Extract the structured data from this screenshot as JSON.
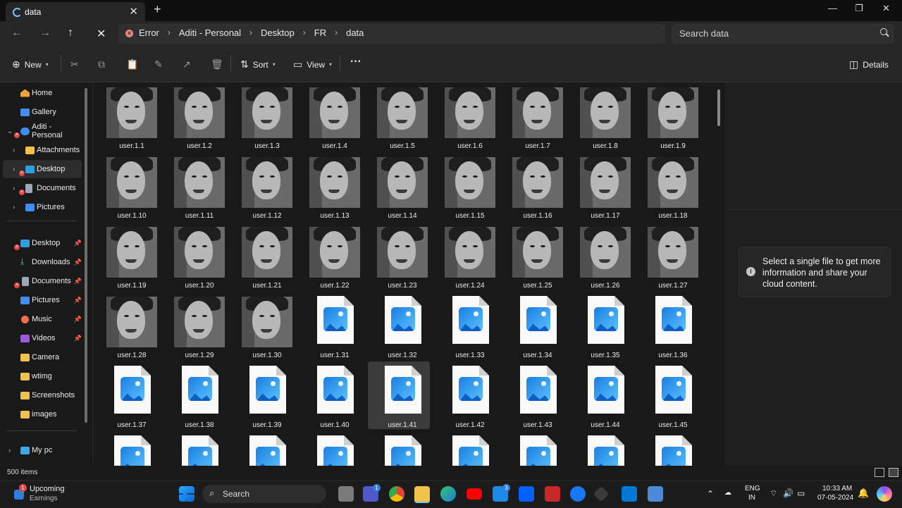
{
  "window": {
    "tab_title": "data",
    "tab_close": "✕",
    "new_tab": "+",
    "minimize": "—",
    "maximize": "❐",
    "close": "✕"
  },
  "address": {
    "back": "←",
    "forward": "→",
    "up": "↑",
    "stop": "✕",
    "error_label": "Error",
    "crumbs": [
      "Aditi - Personal",
      "Desktop",
      "FR",
      "data"
    ],
    "search_placeholder": "Search data"
  },
  "toolbar": {
    "new_label": "New",
    "sort_label": "Sort",
    "view_label": "View",
    "more": "···",
    "details_label": "Details"
  },
  "sidebar": {
    "items": [
      {
        "label": "Home"
      },
      {
        "label": "Gallery"
      },
      {
        "label": "Aditi - Personal"
      },
      {
        "label": "Attachments"
      },
      {
        "label": "Desktop"
      },
      {
        "label": "Documents"
      },
      {
        "label": "Pictures"
      },
      {
        "label": "Desktop"
      },
      {
        "label": "Downloads"
      },
      {
        "label": "Documents"
      },
      {
        "label": "Pictures"
      },
      {
        "label": "Music"
      },
      {
        "label": "Videos"
      },
      {
        "label": "Camera"
      },
      {
        "label": "wtimg"
      },
      {
        "label": "Screenshots"
      },
      {
        "label": "images"
      },
      {
        "label": "My pc"
      }
    ]
  },
  "files": [
    "user.1.1",
    "user.1.2",
    "user.1.3",
    "user.1.4",
    "user.1.5",
    "user.1.6",
    "user.1.7",
    "user.1.8",
    "user.1.9",
    "user.1.10",
    "user.1.11",
    "user.1.12",
    "user.1.13",
    "user.1.14",
    "user.1.15",
    "user.1.16",
    "user.1.17",
    "user.1.18",
    "user.1.19",
    "user.1.20",
    "user.1.21",
    "user.1.22",
    "user.1.23",
    "user.1.24",
    "user.1.25",
    "user.1.26",
    "user.1.27",
    "user.1.28",
    "user.1.29",
    "user.1.30",
    "user.1.31",
    "user.1.32",
    "user.1.33",
    "user.1.34",
    "user.1.35",
    "user.1.36",
    "user.1.37",
    "user.1.38",
    "user.1.39",
    "user.1.40",
    "user.1.41",
    "user.1.42",
    "user.1.43",
    "user.1.44",
    "user.1.45",
    "",
    "",
    "",
    "",
    "",
    "",
    "",
    "",
    ""
  ],
  "selected_file": "user.1.41",
  "details": {
    "message": "Select a single file to get more information and share your cloud content."
  },
  "status": {
    "item_count": "500 items"
  },
  "taskbar": {
    "weather_title": "Upcoming",
    "weather_sub": "Earnings",
    "weather_badge": "1",
    "search_label": "Search",
    "teams_badge": "1",
    "mail_badge": "3",
    "lang1": "ENG",
    "lang2": "IN",
    "time": "10:33 AM",
    "date": "07-05-2024"
  }
}
